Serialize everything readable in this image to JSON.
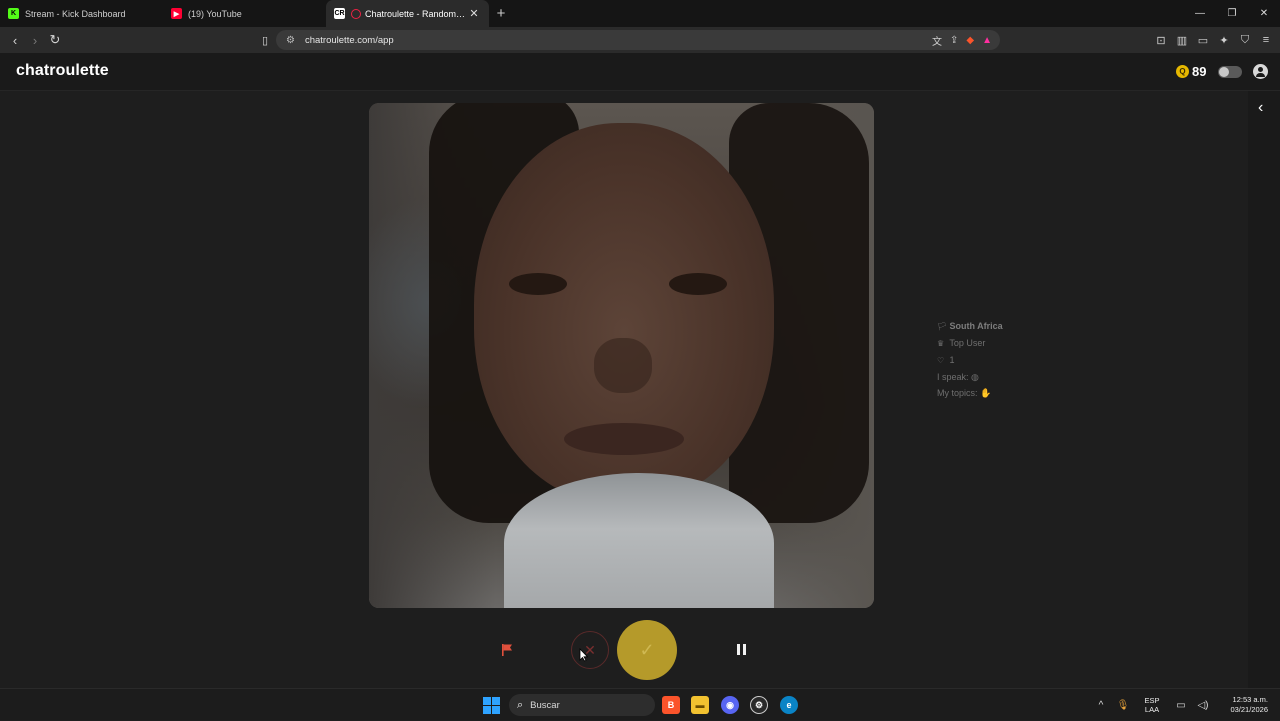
{
  "browser": {
    "tabs": [
      {
        "title": "Stream - Kick Dashboard",
        "icon": "kick-icon",
        "icon_color": "#53fc18"
      },
      {
        "title": "(19) YouTube",
        "icon": "youtube-icon",
        "icon_color": "#ff0033"
      },
      {
        "title": "Chatroulette - Random video",
        "icon": "chatroulette-icon",
        "icon_color": "#ffffff",
        "close": "✕",
        "active": true
      }
    ],
    "new_tab": "+",
    "url": "chatroulette.com/app",
    "window_controls": {
      "minimize": "—",
      "restore": "❐",
      "close": "✕"
    }
  },
  "app": {
    "logo": "chatroulette",
    "coins": "89",
    "coin_symbol": "Q",
    "accent_color": "#b59a2a"
  },
  "partner": {
    "country": "South Africa",
    "badge": "Top User",
    "count": "1",
    "speaks_label": "I speak:",
    "topics_label": "My topics:"
  },
  "controls": {
    "skip_symbol": "✕",
    "confirm_symbol": "✓"
  },
  "taskbar": {
    "search_placeholder": "Buscar",
    "lang_line1": "ESP",
    "lang_line2": "LAA",
    "time": "12:53 a.m.",
    "date": "03/21/2026"
  }
}
